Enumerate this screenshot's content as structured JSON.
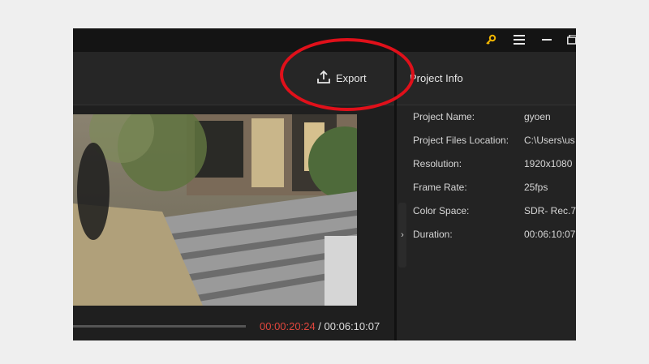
{
  "titlebar": {
    "icons": [
      "key-icon",
      "menu-icon",
      "minimize-icon",
      "maximize-icon"
    ],
    "key_color": "#f0b400"
  },
  "toolbar": {
    "export_label": "Export",
    "export_icon": "upload-icon"
  },
  "preview": {
    "description_icon": "video-frame",
    "timecode_current": "00:00:20:24",
    "timecode_separator": " / ",
    "timecode_total": "00:06:10:07",
    "current_color": "#e0463d"
  },
  "project_info": {
    "title": "Project Info",
    "rows": [
      {
        "label": "Project Name:",
        "value": "gyoen"
      },
      {
        "label": "Project Files Location:",
        "value": "C:\\Users\\us"
      },
      {
        "label": "Resolution:",
        "value": "1920x1080"
      },
      {
        "label": "Frame Rate:",
        "value": "25fps"
      },
      {
        "label": "Color Space:",
        "value": "SDR- Rec.7("
      },
      {
        "label": "Duration:",
        "value": "00:06:10:07"
      }
    ]
  },
  "annotation": {
    "shape": "ellipse",
    "color": "#e0101a"
  }
}
